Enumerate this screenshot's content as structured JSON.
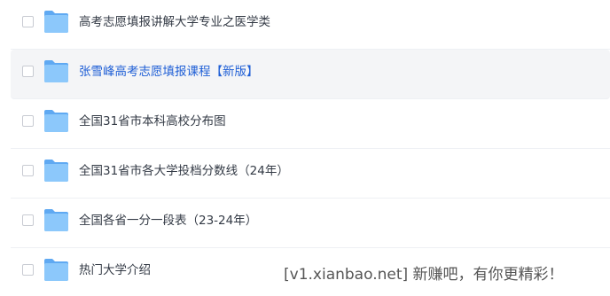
{
  "colors": {
    "accent": "#1f5fd6",
    "folder": "#6fb7f7",
    "row_highlight": "#f4f5f7"
  },
  "files": [
    {
      "name": "高考志愿填报讲解大学专业之医学类",
      "icon": "folder-icon",
      "selected": false,
      "highlighted": false
    },
    {
      "name": "张雪峰高考志愿填报课程【新版】",
      "icon": "folder-icon",
      "selected": false,
      "highlighted": true
    },
    {
      "name": "全国31省市本科高校分布图",
      "icon": "folder-icon",
      "selected": false,
      "highlighted": false
    },
    {
      "name": "全国31省市各大学投档分数线（24年）",
      "icon": "folder-icon",
      "selected": false,
      "highlighted": false
    },
    {
      "name": "全国各省一分一段表（23-24年）",
      "icon": "folder-icon",
      "selected": false,
      "highlighted": false
    },
    {
      "name": "热门大学介绍",
      "icon": "folder-icon",
      "selected": false,
      "highlighted": false
    }
  ],
  "watermark": "[v1.xianbao.net] 新赚吧，有你更精彩！"
}
